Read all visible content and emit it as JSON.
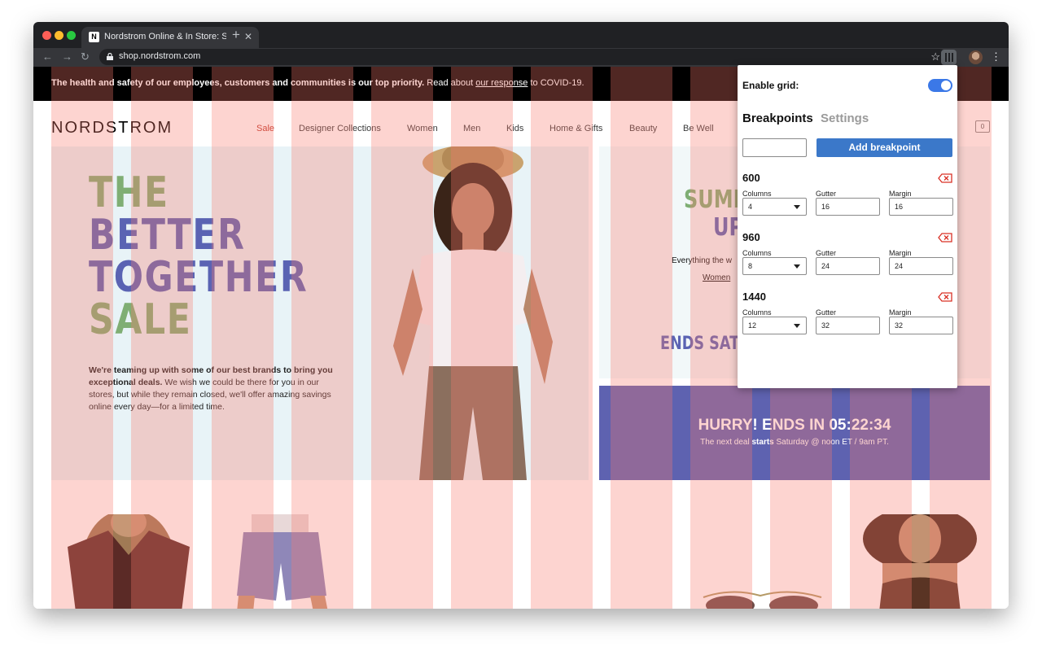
{
  "browser": {
    "tab_title": "Nordstrom Online & In Store: Shoes, Jewelry, Clothing",
    "tab_favicon": "N",
    "tab_close": "✕",
    "new_tab": "+",
    "url": "shop.nordstrom.com",
    "back": "←",
    "forward": "→",
    "reload": "↻",
    "bookmark": "☆",
    "menu": "⋮"
  },
  "banner": {
    "bold_text": "The health and safety of our employees, customers and communities is our top priority.",
    "pre_link": " Read about ",
    "link_text": "our response",
    "post_link": " to COVID-19."
  },
  "header": {
    "logo": "NORDSTROM",
    "nav": [
      "Sale",
      "Designer Collections",
      "Women",
      "Men",
      "Kids",
      "Home & Gifts",
      "Beauty",
      "Be Well"
    ],
    "bag_count": "0"
  },
  "hero": {
    "headline": [
      "THE",
      "BETTER",
      "TOGETHER",
      "SALE"
    ],
    "promo_bold": "We're teaming up with some of our best brands to bring you exceptional deals.",
    "promo_rest": " We wish we could be there for you in our stores, but while they remain closed, we'll offer amazing savings online every day—for a limited time."
  },
  "side_promo": {
    "line1": "SUMM",
    "line2": "UP",
    "subtext": "Everything the w",
    "link": "Women",
    "ends": "ENDS SATU"
  },
  "countdown": {
    "headline": "HURRY! ENDS IN 05:22:34",
    "sub_pre": "The next deal ",
    "sub_bold": "starts",
    "sub_post": " Saturday @ noon ET / 9am PT."
  },
  "popup": {
    "enable_label": "Enable grid:",
    "enabled": true,
    "tab_breakpoints": "Breakpoints",
    "tab_settings": "Settings",
    "new_breakpoint_value": "",
    "add_button": "Add breakpoint",
    "labels": {
      "columns": "Columns",
      "gutter": "Gutter",
      "margin": "Margin"
    },
    "breakpoints": [
      {
        "width": "600",
        "columns": "4",
        "gutter": "16",
        "margin": "16"
      },
      {
        "width": "960",
        "columns": "8",
        "gutter": "24",
        "margin": "24"
      },
      {
        "width": "1440",
        "columns": "12",
        "gutter": "32",
        "margin": "32"
      }
    ]
  },
  "colors": {
    "headline_green": "#7fae74",
    "headline_blue": "#5a63b3",
    "sale_red": "#c0392b",
    "toggle_blue": "#3b78e7",
    "grid_overlay": "#fa786e"
  }
}
